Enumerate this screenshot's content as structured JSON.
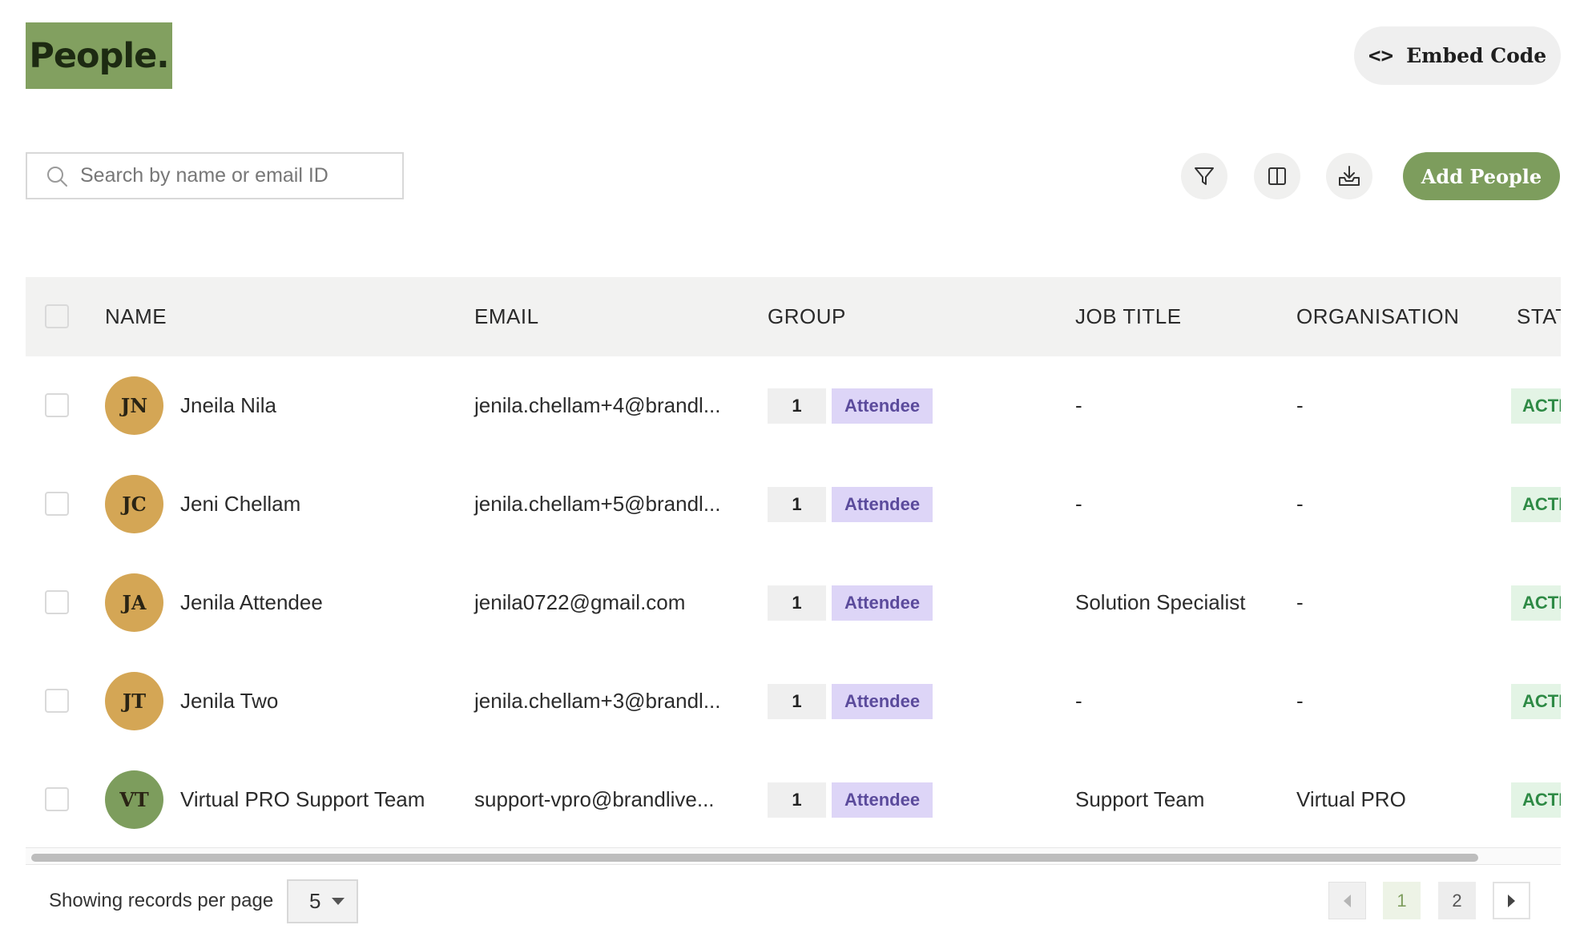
{
  "header": {
    "logo_text": "People.",
    "embed_button": {
      "label": "Embed Code",
      "icon": "code-brackets-icon"
    }
  },
  "toolbar": {
    "search": {
      "placeholder": "Search by name or email ID",
      "value": ""
    },
    "filter_icon": "filter-icon",
    "columns_icon": "columns-icon",
    "export_icon": "download-tray-icon",
    "add_button_label": "Add People"
  },
  "table": {
    "columns": [
      "NAME",
      "EMAIL",
      "GROUP",
      "JOB TITLE",
      "ORGANISATION",
      "STATUS"
    ],
    "rows": [
      {
        "initials": "JN",
        "name": "Jneila Nila",
        "email": "jenila.chellam+4@brandl...",
        "group_count": "1",
        "group": "Attendee",
        "job_title": "-",
        "organisation": "-",
        "status": "ACTIVE",
        "avatar_color": "#d4a655"
      },
      {
        "initials": "JC",
        "name": "Jeni Chellam",
        "email": "jenila.chellam+5@brandl...",
        "group_count": "1",
        "group": "Attendee",
        "job_title": "-",
        "organisation": "-",
        "status": "ACTIVE",
        "avatar_color": "#d4a655"
      },
      {
        "initials": "JA",
        "name": "Jenila Attendee",
        "email": "jenila0722@gmail.com",
        "group_count": "1",
        "group": "Attendee",
        "job_title": "Solution Specialist",
        "organisation": "-",
        "status": "ACTIVE",
        "avatar_color": "#d4a655"
      },
      {
        "initials": "JT",
        "name": "Jenila Two",
        "email": "jenila.chellam+3@brandl...",
        "group_count": "1",
        "group": "Attendee",
        "job_title": "-",
        "organisation": "-",
        "status": "ACTIVE",
        "avatar_color": "#d4a655"
      },
      {
        "initials": "VT",
        "name": "Virtual PRO Support Team",
        "email": "support-vpro@brandlive...",
        "group_count": "1",
        "group": "Attendee",
        "job_title": "Support Team",
        "organisation": "Virtual PRO",
        "status": "ACTIVE",
        "avatar_color": "#7d9d5d"
      }
    ]
  },
  "pagination": {
    "per_page_label": "Showing records per page",
    "per_page_value": "5",
    "pages": [
      "1",
      "2"
    ],
    "current_page": "1"
  },
  "colors": {
    "brand_green": "#7d9d5d",
    "logo_bg": "#82a060",
    "tag_purple_bg": "#ddd5f7",
    "status_green_bg": "#e3f4e5"
  }
}
